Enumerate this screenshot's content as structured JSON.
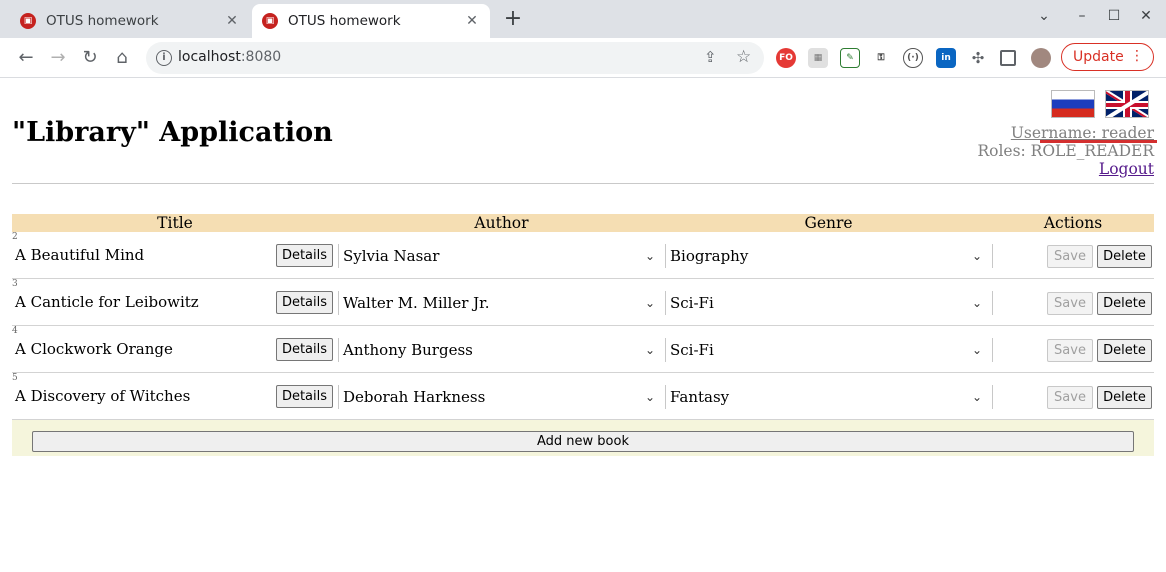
{
  "browser": {
    "tabs": [
      {
        "title": "OTUS homework",
        "active": false
      },
      {
        "title": "OTUS homework",
        "active": true
      }
    ],
    "url_host": "localhost",
    "url_port": ":8080",
    "update_label": "Update"
  },
  "app": {
    "title": "\"Library\" Application",
    "user": {
      "username": "Username: reader",
      "roles": "Roles: ROLE_READER",
      "logout": "Logout"
    },
    "columns": [
      "Title",
      "Author",
      "Genre",
      "Actions"
    ],
    "books": [
      {
        "id": "2",
        "title": "A Beautiful Mind",
        "author": "Sylvia Nasar",
        "genre": "Biography"
      },
      {
        "id": "3",
        "title": "A Canticle for Leibowitz",
        "author": "Walter M. Miller Jr.",
        "genre": "Sci-Fi"
      },
      {
        "id": "4",
        "title": "A Clockwork Orange",
        "author": "Anthony Burgess",
        "genre": "Sci-Fi"
      },
      {
        "id": "5",
        "title": "A Discovery of Witches",
        "author": "Deborah Harkness",
        "genre": "Fantasy"
      }
    ],
    "details_label": "Details",
    "save_label": "Save",
    "delete_label": "Delete",
    "add_label": "Add new book"
  },
  "colors": {
    "header_bg": "#f5deb3",
    "add_row_bg": "#f5f5dc",
    "update_accent": "#d93025"
  }
}
